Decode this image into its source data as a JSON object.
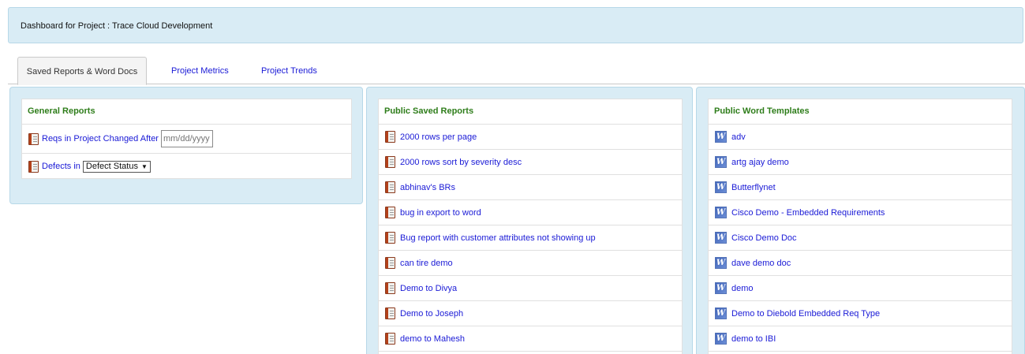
{
  "header": {
    "title": "Dashboard for Project : Trace Cloud Development"
  },
  "tabs": [
    {
      "label": "Saved Reports & Word Docs"
    },
    {
      "label": "Project Metrics"
    },
    {
      "label": "Project Trends"
    }
  ],
  "general_reports": {
    "title": "General Reports",
    "reqs_label": "Reqs in Project Changed After",
    "date_placeholder": "mm/dd/yyyy",
    "defects_label": "Defects in",
    "defects_select": "Defect Status"
  },
  "public_saved_reports": {
    "title": "Public Saved Reports",
    "items": [
      "2000 rows per page",
      "2000 rows sort by severity desc",
      "abhinav's BRs",
      "bug in export to word",
      "Bug report with customer attributes not showing up",
      "can tire demo",
      "Demo to Divya",
      "Demo to Joseph",
      "demo to Mahesh"
    ]
  },
  "public_word_templates": {
    "title": "Public Word Templates",
    "items": [
      "adv",
      "artg ajay demo",
      "Butterflynet",
      "Cisco Demo - Embedded Requirements",
      "Cisco Demo Doc",
      "dave demo doc",
      "demo",
      "Demo to Diebold Embedded Req Type",
      "demo to IBI"
    ]
  },
  "icons": {
    "report": "report-icon",
    "word": "word-doc-icon",
    "dropdown": "chevron-down-icon"
  },
  "colors": {
    "panel_bg": "#d9ecf5",
    "link": "#1a1ad6",
    "section_title": "#2e7d1a"
  }
}
